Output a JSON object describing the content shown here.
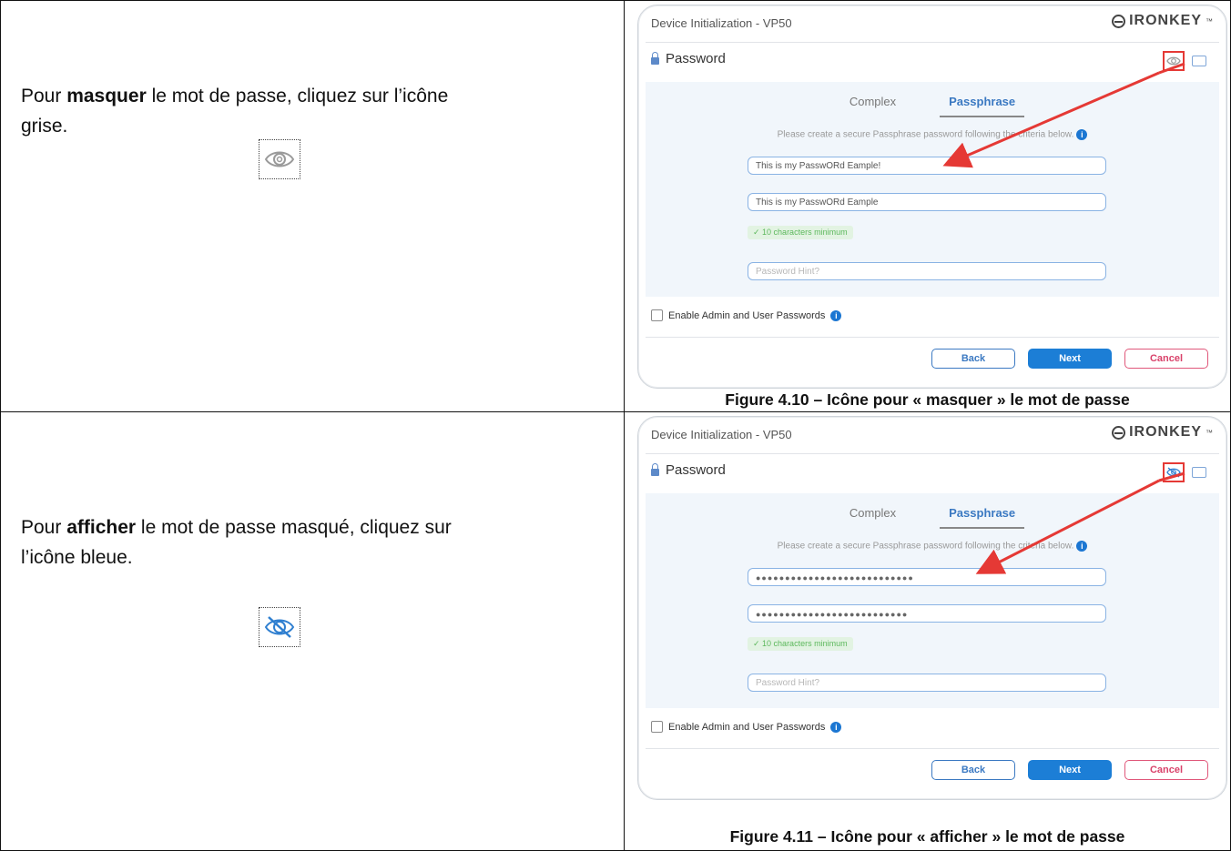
{
  "rows": [
    {
      "instruction": {
        "prefix": "Pour ",
        "bold": "masquer",
        "suffix": " le mot de passe, cliquez sur l’icône grise."
      },
      "icon": "eye-icon",
      "icon_color": "#9a9a9a",
      "dialog": {
        "window_title": "Device Initialization - VP50",
        "logo_text": "IRONKEY",
        "logo_mark": "™",
        "section_title": "Password",
        "tabs": [
          "Complex",
          "Passphrase"
        ],
        "active_tab": "Passphrase",
        "criteria_text": "Please create a secure Passphrase password following the criteria below.",
        "info_glyph": "i",
        "password_value": "This is my PasswORd Eample!",
        "confirm_value": "This is my PasswORd Eample",
        "requirement_badge": "✓ 10 characters minimum",
        "hint_placeholder": "Password Hint?",
        "enable_label": "Enable Admin and User Passwords",
        "buttons": {
          "back": "Back",
          "next": "Next",
          "cancel": "Cancel"
        }
      },
      "caption": "Figure 4.10 – Icône pour « masquer » le mot de passe"
    },
    {
      "instruction": {
        "prefix": "Pour ",
        "bold": "afficher",
        "suffix": " le mot de passe masqué, cliquez sur l’icône bleue."
      },
      "icon": "eye-slash-icon",
      "icon_color": "#2f7fd0",
      "dialog": {
        "window_title": "Device Initialization - VP50",
        "logo_text": "IRONKEY",
        "logo_mark": "™",
        "section_title": "Password",
        "tabs": [
          "Complex",
          "Passphrase"
        ],
        "active_tab": "Passphrase",
        "criteria_text": "Please create a secure Passphrase password following the criteria below.",
        "info_glyph": "i",
        "password_value": "●●●●●●●●●●●●●●●●●●●●●●●●●●●",
        "confirm_value": "●●●●●●●●●●●●●●●●●●●●●●●●●●",
        "requirement_badge": "✓ 10 characters minimum",
        "hint_placeholder": "Password Hint?",
        "enable_label": "Enable Admin and User Passwords",
        "buttons": {
          "back": "Back",
          "next": "Next",
          "cancel": "Cancel"
        }
      },
      "caption": "Figure 4.11 – Icône pour « afficher » le mot de passe"
    }
  ],
  "colors": {
    "accent_blue": "#1c7ed6",
    "annotation_red": "#e53935",
    "cancel_pink": "#d9426a",
    "panel_bg": "#f1f6fb"
  }
}
